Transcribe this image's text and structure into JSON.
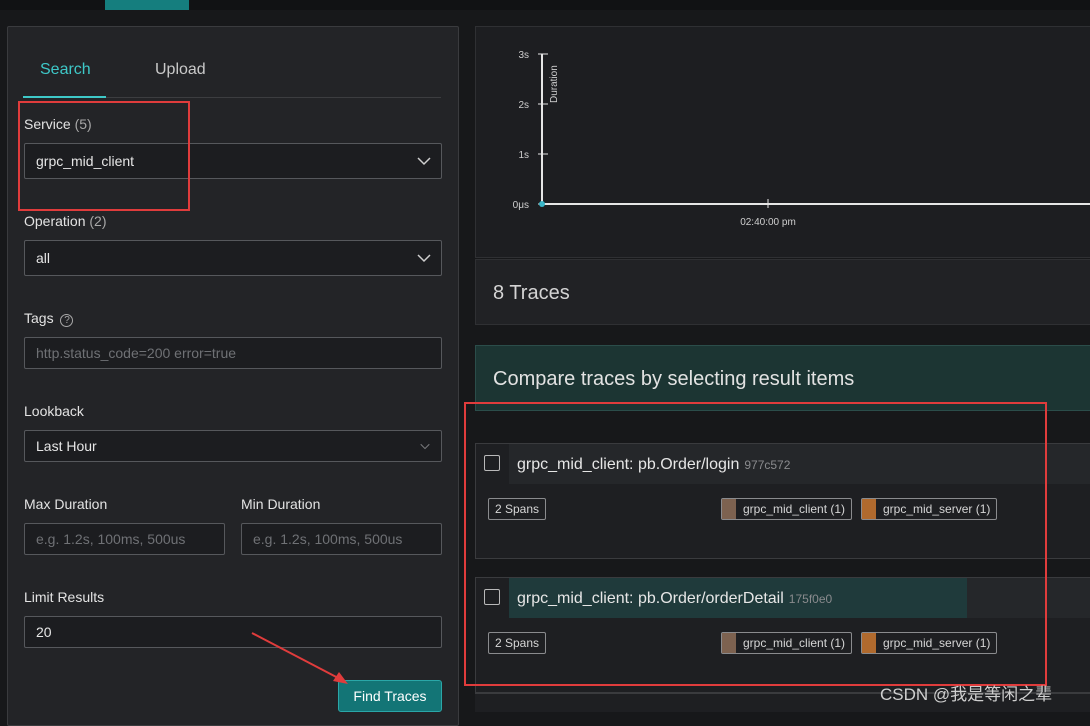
{
  "search_panel": {
    "tabs": [
      {
        "label": "Search"
      },
      {
        "label": "Upload"
      }
    ],
    "service": {
      "label": "Service",
      "count": "(5)",
      "value": "grpc_mid_client"
    },
    "operation": {
      "label": "Operation",
      "count": "(2)",
      "value": "all"
    },
    "tags": {
      "label": "Tags",
      "help_icon": "?",
      "placeholder": "http.status_code=200 error=true"
    },
    "lookback": {
      "label": "Lookback",
      "value": "Last Hour"
    },
    "max_duration": {
      "label": "Max Duration",
      "placeholder": "e.g. 1.2s, 100ms, 500us"
    },
    "min_duration": {
      "label": "Min Duration",
      "placeholder": "e.g. 1.2s, 100ms, 500us"
    },
    "limit": {
      "label": "Limit Results",
      "value": "20"
    },
    "find_button": "Find Traces"
  },
  "chart_data": {
    "type": "scatter",
    "ylabel": "Duration",
    "y_ticks": [
      "3s",
      "2s",
      "1s",
      "0μs"
    ],
    "x_ticks": [
      "02:40:00 pm"
    ],
    "points": [
      {
        "x": "start",
        "y": 0
      }
    ]
  },
  "results": {
    "traces_title": "8 Traces",
    "compare_title": "Compare traces by selecting result items",
    "items": [
      {
        "name": "grpc_mid_client: pb.Order/login",
        "id": "977c572",
        "spans": "2 Spans",
        "services": [
          {
            "label": "grpc_mid_client (1)",
            "color": "#7d6250"
          },
          {
            "label": "grpc_mid_server (1)",
            "color": "#b06a2e"
          }
        ]
      },
      {
        "name": "grpc_mid_client: pb.Order/orderDetail",
        "id": "175f0e0",
        "spans": "2 Spans",
        "services": [
          {
            "label": "grpc_mid_client (1)",
            "color": "#7d6250"
          },
          {
            "label": "grpc_mid_server (1)",
            "color": "#b06a2e"
          }
        ]
      }
    ]
  },
  "watermark": "CSDN @我是等闲之辈",
  "colors": {
    "accent": "#3ec8c8",
    "primary_button": "#137576",
    "annotation": "#e03c3c"
  }
}
